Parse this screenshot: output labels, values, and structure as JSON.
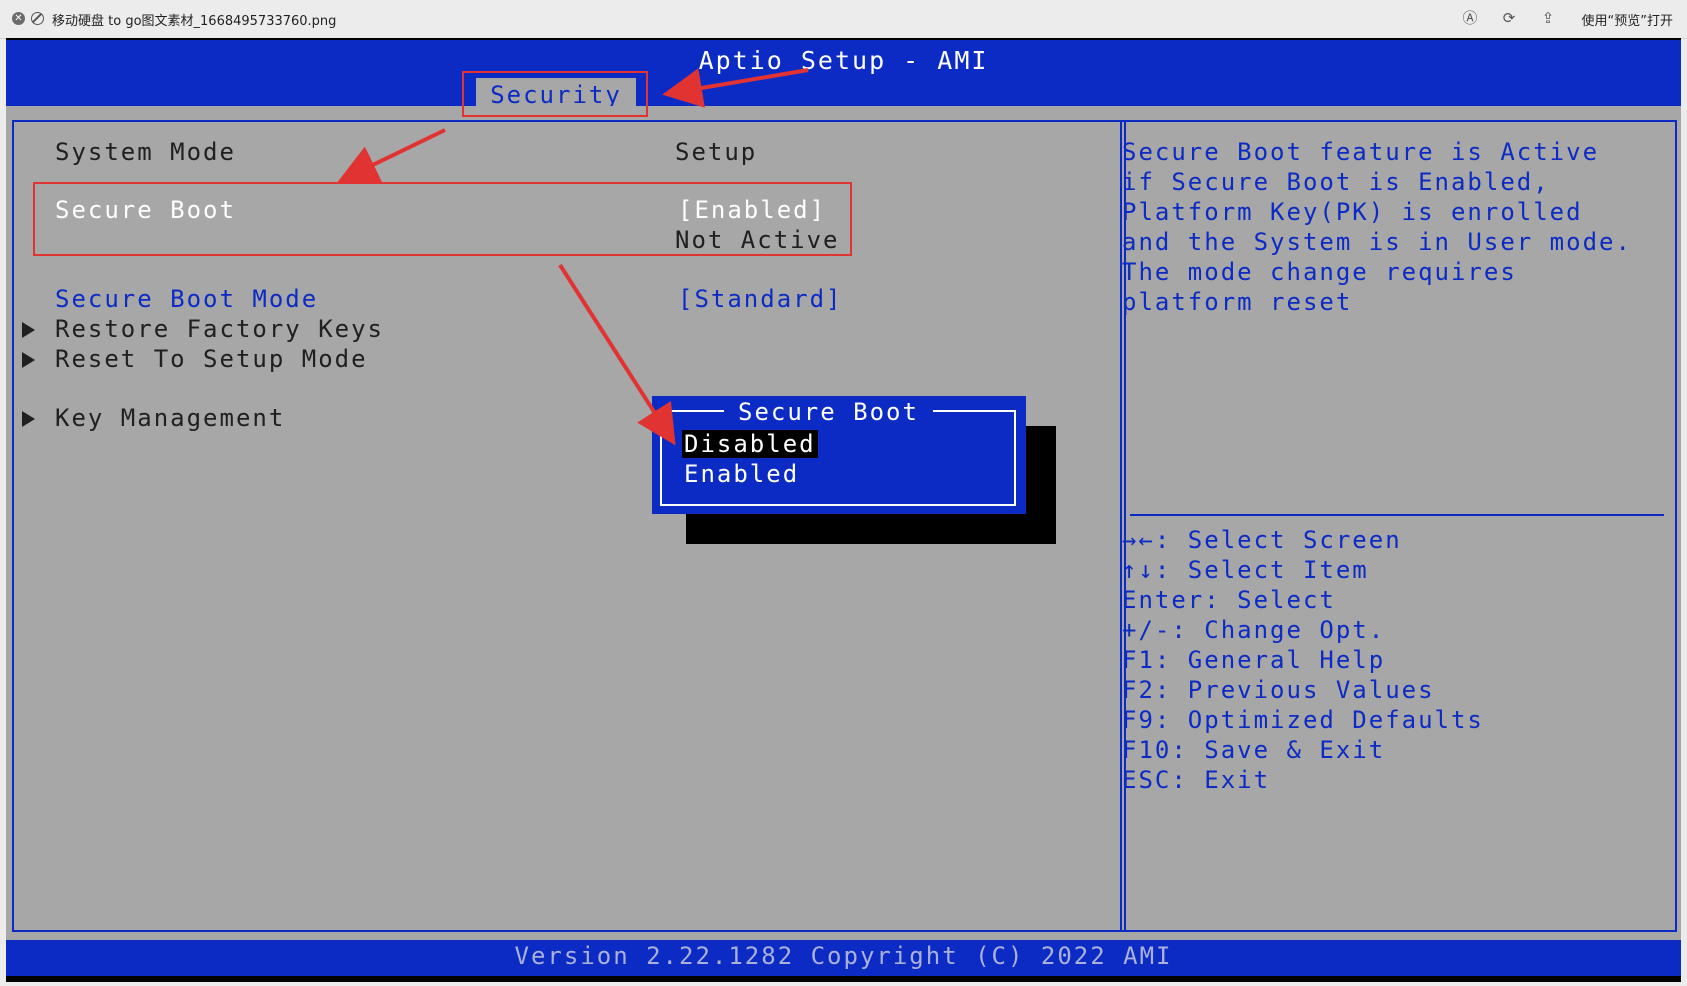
{
  "window": {
    "filename": "移动硬盘 to go图文素材_1668495733760.png",
    "open_with": "使用“预览”打开"
  },
  "bios": {
    "title": "Aptio Setup - AMI",
    "active_tab": "Security",
    "items": {
      "system_mode_label": "System Mode",
      "system_mode_value": "Setup",
      "secure_boot_label": "Secure Boot",
      "secure_boot_value": "[Enabled]",
      "secure_boot_status": "Not Active",
      "secure_boot_mode_label": "Secure Boot Mode",
      "secure_boot_mode_value": "[Standard]",
      "restore_factory_keys": "Restore Factory Keys",
      "reset_to_setup_mode": "Reset To Setup Mode",
      "key_management": "Key Management"
    },
    "help_text": [
      "Secure Boot feature is Active",
      "if Secure Boot is Enabled,",
      "Platform Key(PK) is enrolled",
      "and the System is in User mode.",
      "The mode change requires",
      "platform reset"
    ],
    "key_hints": [
      "→←: Select Screen",
      "↑↓: Select Item",
      "Enter: Select",
      "+/-: Change Opt.",
      "F1: General Help",
      "F2: Previous Values",
      "F9: Optimized Defaults",
      "F10: Save & Exit",
      "ESC: Exit"
    ],
    "popup": {
      "title": "Secure Boot",
      "options": [
        "Disabled",
        "Enabled"
      ],
      "selected": "Disabled"
    },
    "footer": "Version 2.22.1282 Copyright (C) 2022 AMI"
  },
  "colors": {
    "bios_blue": "#0c2bc4",
    "bios_gray": "#a7a7a7",
    "annotation_red": "#e23333"
  }
}
